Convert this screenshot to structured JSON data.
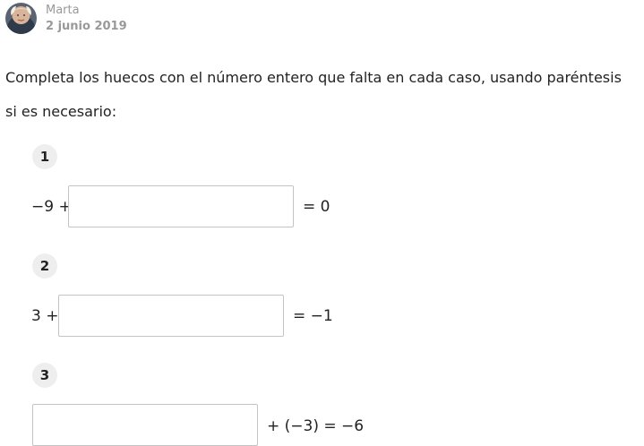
{
  "author": {
    "name": "Marta",
    "date": "2 junio 2019",
    "avatar_icon": "user-avatar-photo"
  },
  "intro": "Completa los huecos con el número entero que falta en cada caso, usando paréntesis si es necesario:",
  "exercises": [
    {
      "number": "1",
      "before": "−9 +",
      "after": "= 0",
      "answer": ""
    },
    {
      "number": "2",
      "before": "3 +",
      "after": "= −1",
      "answer": ""
    },
    {
      "number": "3",
      "before": "",
      "after": "+ (−3) = −6",
      "answer": ""
    }
  ],
  "colors": {
    "text": "#222222",
    "meta": "#999999",
    "badge_bg": "#eeeeee",
    "input_border": "#c4c4c4"
  }
}
